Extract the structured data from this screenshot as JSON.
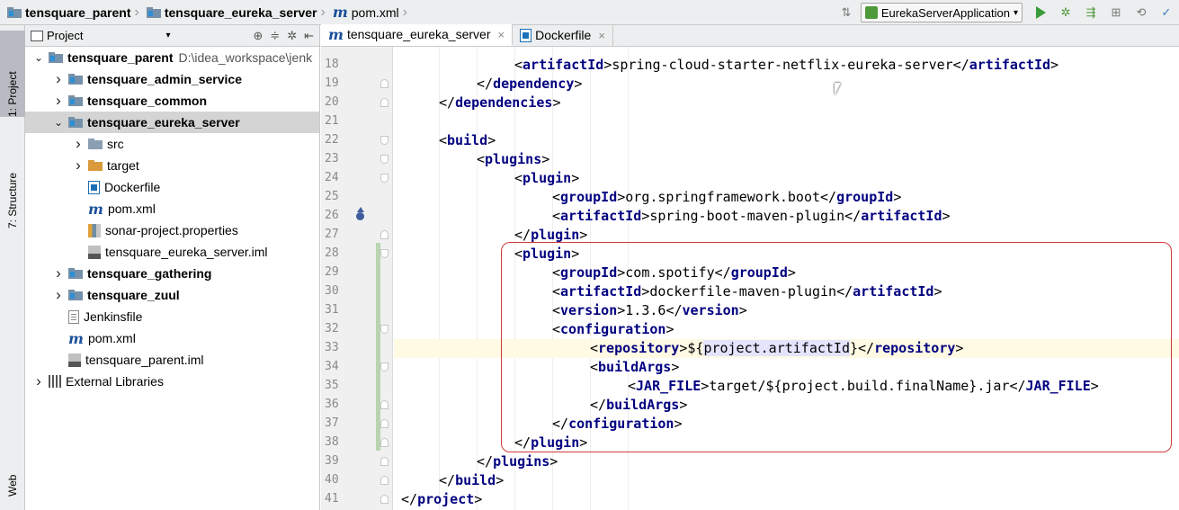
{
  "navbar": {
    "crumbs": [
      {
        "label": "tensquare_parent",
        "icon": "module-folder-icon"
      },
      {
        "label": "tensquare_eureka_server",
        "icon": "module-folder-icon"
      },
      {
        "label": "pom.xml",
        "icon": "maven-m-icon"
      }
    ],
    "run_config": "EurekaServerApplication"
  },
  "left_strip": {
    "tabs": [
      {
        "label": "1: Project",
        "active": true
      },
      {
        "label": "7: Structure"
      },
      {
        "label": "Web"
      }
    ]
  },
  "project_panel": {
    "header_label": "Project",
    "tree": [
      {
        "name": "tensquare_parent",
        "path": "D:\\idea_workspace\\jenk",
        "icon": "module-folder-icon",
        "arrow": "expanded",
        "depth": 0,
        "bold": true
      },
      {
        "name": "tensquare_admin_service",
        "icon": "module-folder-icon",
        "arrow": "collapsed",
        "depth": 1,
        "bold": true
      },
      {
        "name": "tensquare_common",
        "icon": "module-folder-icon",
        "arrow": "collapsed",
        "depth": 1,
        "bold": true
      },
      {
        "name": "tensquare_eureka_server",
        "icon": "module-folder-icon",
        "arrow": "expanded",
        "depth": 1,
        "bold": true,
        "selected": true
      },
      {
        "name": "src",
        "icon": "folder-icon",
        "arrow": "collapsed",
        "depth": 2
      },
      {
        "name": "target",
        "icon": "excluded-folder-icon",
        "arrow": "collapsed",
        "depth": 2
      },
      {
        "name": "Dockerfile",
        "icon": "docker-file-icon",
        "depth": 2
      },
      {
        "name": "pom.xml",
        "icon": "maven-m-icon",
        "depth": 2
      },
      {
        "name": "sonar-project.properties",
        "icon": "properties-file-icon",
        "depth": 2
      },
      {
        "name": "tensquare_eureka_server.iml",
        "icon": "iml-file-icon",
        "depth": 2
      },
      {
        "name": "tensquare_gathering",
        "icon": "module-folder-icon",
        "arrow": "collapsed",
        "depth": 1,
        "bold": true
      },
      {
        "name": "tensquare_zuul",
        "icon": "module-folder-icon",
        "arrow": "collapsed",
        "depth": 1,
        "bold": true
      },
      {
        "name": "Jenkinsfile",
        "icon": "text-file-icon",
        "depth": 1
      },
      {
        "name": "pom.xml",
        "icon": "maven-m-icon",
        "depth": 1
      },
      {
        "name": "tensquare_parent.iml",
        "icon": "iml-file-icon",
        "depth": 1
      },
      {
        "name": "External Libraries",
        "icon": "libraries-icon",
        "arrow": "collapsed",
        "depth": 0
      }
    ]
  },
  "editor_tabs": [
    {
      "label": "tensquare_eureka_server",
      "icon": "maven-m-icon",
      "active": true
    },
    {
      "label": "Dockerfile",
      "icon": "docker-file-icon"
    }
  ],
  "editor": {
    "lines": [
      {
        "num": "18",
        "indent": 3,
        "tokens": [
          {
            "t": "<",
            "c": "br"
          },
          {
            "t": "artifactId",
            "c": "tg"
          },
          {
            "t": ">",
            "c": "br"
          },
          {
            "t": "spring-cloud-starter-netflix-eureka-server",
            "c": "tx"
          },
          {
            "t": "</",
            "c": "br"
          },
          {
            "t": "artifactId",
            "c": "tg"
          },
          {
            "t": ">",
            "c": "br"
          }
        ]
      },
      {
        "num": "19",
        "indent": 2,
        "fold": "up",
        "tokens": [
          {
            "t": "</",
            "c": "br"
          },
          {
            "t": "dependency",
            "c": "tg"
          },
          {
            "t": ">",
            "c": "br"
          }
        ]
      },
      {
        "num": "20",
        "indent": 1,
        "fold": "up",
        "tokens": [
          {
            "t": "</",
            "c": "br"
          },
          {
            "t": "dependencies",
            "c": "tg"
          },
          {
            "t": ">",
            "c": "br"
          }
        ]
      },
      {
        "num": "21",
        "indent": 0,
        "tokens": []
      },
      {
        "num": "22",
        "indent": 1,
        "fold": "down",
        "tokens": [
          {
            "t": "<",
            "c": "br"
          },
          {
            "t": "build",
            "c": "tg"
          },
          {
            "t": ">",
            "c": "br"
          }
        ]
      },
      {
        "num": "23",
        "indent": 2,
        "fold": "down",
        "tokens": [
          {
            "t": "<",
            "c": "br"
          },
          {
            "t": "plugins",
            "c": "tg"
          },
          {
            "t": ">",
            "c": "br"
          }
        ]
      },
      {
        "num": "24",
        "indent": 3,
        "fold": "down",
        "tokens": [
          {
            "t": "<",
            "c": "br"
          },
          {
            "t": "plugin",
            "c": "tg"
          },
          {
            "t": ">",
            "c": "br"
          }
        ]
      },
      {
        "num": "25",
        "indent": 4,
        "tokens": [
          {
            "t": "<",
            "c": "br"
          },
          {
            "t": "groupId",
            "c": "tg"
          },
          {
            "t": ">",
            "c": "br"
          },
          {
            "t": "org.springframework.boot",
            "c": "tx"
          },
          {
            "t": "</",
            "c": "br"
          },
          {
            "t": "groupId",
            "c": "tg"
          },
          {
            "t": ">",
            "c": "br"
          }
        ]
      },
      {
        "num": "26",
        "indent": 4,
        "tokens": [
          {
            "t": "<",
            "c": "br"
          },
          {
            "t": "artifactId",
            "c": "tg"
          },
          {
            "t": ">",
            "c": "br"
          },
          {
            "t": "spring-boot-maven-plugin",
            "c": "tx"
          },
          {
            "t": "</",
            "c": "br"
          },
          {
            "t": "artifactId",
            "c": "tg"
          },
          {
            "t": ">",
            "c": "br"
          }
        ]
      },
      {
        "num": "27",
        "indent": 3,
        "fold": "up",
        "tokens": [
          {
            "t": "</",
            "c": "br"
          },
          {
            "t": "plugin",
            "c": "tg"
          },
          {
            "t": ">",
            "c": "br"
          }
        ]
      },
      {
        "num": "28",
        "indent": 3,
        "fold": "down",
        "tokens": [
          {
            "t": "<",
            "c": "br"
          },
          {
            "t": "plugin",
            "c": "tg"
          },
          {
            "t": ">",
            "c": "br"
          }
        ]
      },
      {
        "num": "29",
        "indent": 4,
        "tokens": [
          {
            "t": "<",
            "c": "br"
          },
          {
            "t": "groupId",
            "c": "tg"
          },
          {
            "t": ">",
            "c": "br"
          },
          {
            "t": "com.spotify",
            "c": "tx"
          },
          {
            "t": "</",
            "c": "br"
          },
          {
            "t": "groupId",
            "c": "tg"
          },
          {
            "t": ">",
            "c": "br"
          }
        ]
      },
      {
        "num": "30",
        "indent": 4,
        "tokens": [
          {
            "t": "<",
            "c": "br"
          },
          {
            "t": "artifactId",
            "c": "tg"
          },
          {
            "t": ">",
            "c": "br"
          },
          {
            "t": "dockerfile-maven-plugin",
            "c": "tx"
          },
          {
            "t": "</",
            "c": "br"
          },
          {
            "t": "artifactId",
            "c": "tg"
          },
          {
            "t": ">",
            "c": "br"
          }
        ]
      },
      {
        "num": "31",
        "indent": 4,
        "tokens": [
          {
            "t": "<",
            "c": "br"
          },
          {
            "t": "version",
            "c": "tg"
          },
          {
            "t": ">",
            "c": "br"
          },
          {
            "t": "1.3.6",
            "c": "tx"
          },
          {
            "t": "</",
            "c": "br"
          },
          {
            "t": "version",
            "c": "tg"
          },
          {
            "t": ">",
            "c": "br"
          }
        ]
      },
      {
        "num": "32",
        "indent": 4,
        "fold": "down",
        "tokens": [
          {
            "t": "<",
            "c": "br"
          },
          {
            "t": "configuration",
            "c": "tg"
          },
          {
            "t": ">",
            "c": "br"
          }
        ]
      },
      {
        "num": "33",
        "indent": 5,
        "caret": true,
        "tokens": [
          {
            "t": "<",
            "c": "br"
          },
          {
            "t": "repository",
            "c": "tg"
          },
          {
            "t": ">",
            "c": "br"
          },
          {
            "t": "${",
            "c": "tx"
          },
          {
            "t": "project.artifactId",
            "c": "hl"
          },
          {
            "t": "}",
            "c": "tx"
          },
          {
            "t": "</",
            "c": "br"
          },
          {
            "t": "repository",
            "c": "tg"
          },
          {
            "t": ">",
            "c": "br"
          }
        ]
      },
      {
        "num": "34",
        "indent": 5,
        "fold": "down",
        "tokens": [
          {
            "t": "<",
            "c": "br"
          },
          {
            "t": "buildArgs",
            "c": "tg"
          },
          {
            "t": ">",
            "c": "br"
          }
        ]
      },
      {
        "num": "35",
        "indent": 6,
        "tokens": [
          {
            "t": "<",
            "c": "br"
          },
          {
            "t": "JAR_FILE",
            "c": "tg"
          },
          {
            "t": ">",
            "c": "br"
          },
          {
            "t": "target/${project.build.finalName}.jar",
            "c": "tx"
          },
          {
            "t": "</",
            "c": "br"
          },
          {
            "t": "JAR_FILE",
            "c": "tg"
          },
          {
            "t": ">",
            "c": "br"
          }
        ]
      },
      {
        "num": "36",
        "indent": 5,
        "fold": "up",
        "tokens": [
          {
            "t": "</",
            "c": "br"
          },
          {
            "t": "buildArgs",
            "c": "tg"
          },
          {
            "t": ">",
            "c": "br"
          }
        ]
      },
      {
        "num": "37",
        "indent": 4,
        "fold": "up",
        "tokens": [
          {
            "t": "</",
            "c": "br"
          },
          {
            "t": "configuration",
            "c": "tg"
          },
          {
            "t": ">",
            "c": "br"
          }
        ]
      },
      {
        "num": "38",
        "indent": 3,
        "fold": "up",
        "tokens": [
          {
            "t": "</",
            "c": "br"
          },
          {
            "t": "plugin",
            "c": "tg"
          },
          {
            "t": ">",
            "c": "br"
          }
        ]
      },
      {
        "num": "39",
        "indent": 2,
        "fold": "up",
        "tokens": [
          {
            "t": "</",
            "c": "br"
          },
          {
            "t": "plugins",
            "c": "tg"
          },
          {
            "t": ">",
            "c": "br"
          }
        ]
      },
      {
        "num": "40",
        "indent": 1,
        "fold": "up",
        "tokens": [
          {
            "t": "</",
            "c": "br"
          },
          {
            "t": "build",
            "c": "tg"
          },
          {
            "t": ">",
            "c": "br"
          }
        ]
      },
      {
        "num": "41",
        "indent": 0,
        "fold": "up",
        "tokens": [
          {
            "t": "</",
            "c": "br"
          },
          {
            "t": "project",
            "c": "tg"
          },
          {
            "t": ">",
            "c": "br"
          }
        ]
      }
    ]
  },
  "colors": {
    "tag": "#000080",
    "highlight_box": "#d33a3a",
    "caret_line": "#fffae3"
  }
}
